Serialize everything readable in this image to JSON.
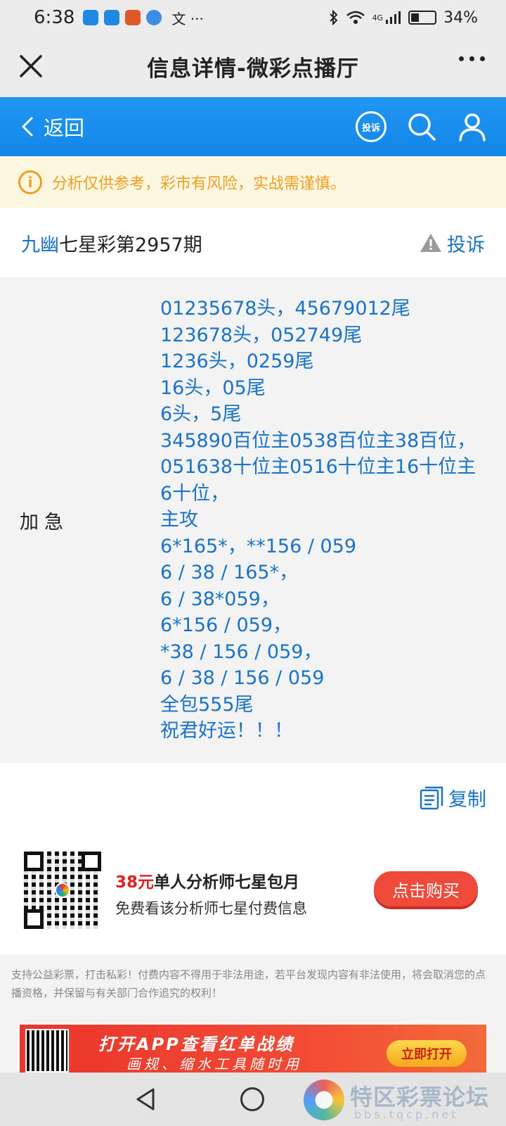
{
  "status_bar": {
    "time": "6:38",
    "network": "4G",
    "battery_percent": "34%",
    "battery_level": 0.34,
    "app_icon_colors": [
      "#1e88e5",
      "#1e88e5",
      "#e0592a",
      "#3a8ee6"
    ],
    "extra_glyph": "文 ···"
  },
  "window": {
    "title": "信息详情-微彩点播厅",
    "close_icon": "close-icon",
    "more_icon": "more-icon"
  },
  "nav": {
    "back_label": "返回",
    "complain_label": "投诉",
    "search_icon": "search-icon",
    "user_icon": "user-icon",
    "accent_color": "#1a86e8"
  },
  "notice": {
    "text": "分析仅供参考，彩市有风险，实战需谨慎。"
  },
  "post": {
    "author": "九幽",
    "title": "七星彩第2957期",
    "report_label": "投诉"
  },
  "content": {
    "label": "加急",
    "lines": [
      "01235678头，45679012尾",
      "123678头，052749尾",
      "1236头，0259尾",
      "16头，05尾",
      "6头，5尾",
      "345890百位主0538百位主38百位，",
      "051638十位主0516十位主16十位主",
      "6十位，",
      "主攻",
      "6*165*，**156 / 059",
      "6 / 38 / 165*，",
      "6 / 38*059，",
      "6*156 / 059，",
      "*38 / 156 / 059，",
      "6 / 38 / 156 / 059",
      "全包555尾",
      "祝君好运！！！"
    ]
  },
  "actions": {
    "copy_label": "复制"
  },
  "promo": {
    "price": "38元",
    "title": "单人分析师七星包月",
    "subtitle": "免费看该分析师七星付费信息",
    "buy_label": "点击购买"
  },
  "disclaimer": "支持公益彩票，打击私彩！付费内容不得用于非法用途，若平台发现内容有非法使用，将会取消您的点播资格，并保留与有关部门合作追究的权利！",
  "banner": {
    "headline": "打开APP查看红单战绩",
    "subline": "画规、缩水工具随时用",
    "button": "立即打开"
  },
  "watermark": {
    "name": "特区彩票论坛",
    "url": "bbs.tqcp.net"
  }
}
